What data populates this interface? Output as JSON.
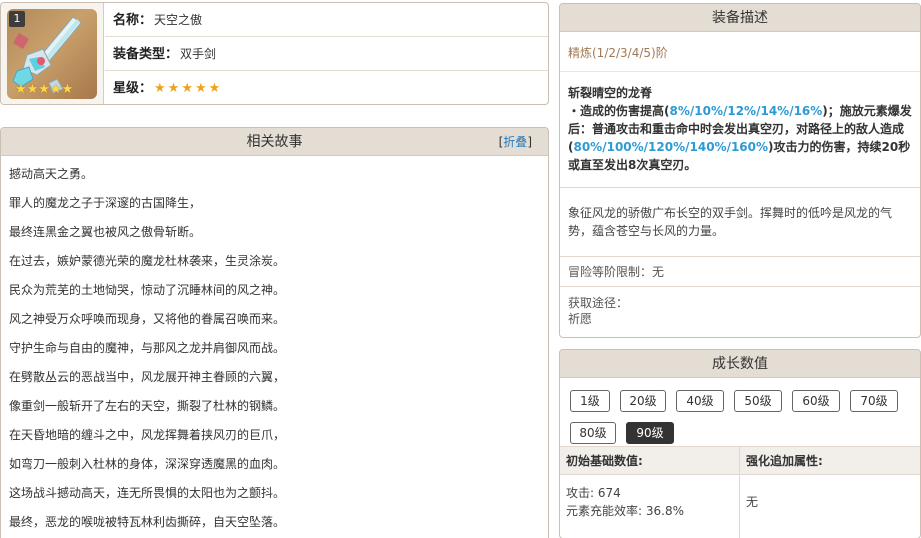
{
  "weapon": {
    "rank": "1",
    "name_label": "名称：",
    "name": "天空之傲",
    "type_label": "装备类型：",
    "type": "双手剑",
    "rarity_label": "星级：",
    "stars": "★★★★★",
    "portrait_stars": "★★★★★",
    "rarity_value": 5
  },
  "story": {
    "title": "相关故事",
    "toggle_open": "[",
    "toggle_label": "折叠",
    "toggle_close": "]",
    "lines": [
      "撼动高天之勇。",
      "罪人的魔龙之子于深邃的古国降生，",
      "最终连黑金之翼也被风之傲骨斩断。",
      "在过去，嫉妒蒙德光荣的魔龙杜林袭来，生灵涂炭。",
      "民众为荒芜的土地恸哭，惊动了沉睡林间的风之神。",
      "风之神受万众呼唤而现身，又将他的眷属召唤而来。",
      "守护生命与自由的魔神，与那风之龙并肩御风而战。",
      "在劈散丛云的恶战当中，风龙展开神主眷顾的六翼，",
      "像重剑一般斩开了左右的天空，撕裂了杜林的钢鳞。",
      "在天昏地暗的缠斗之中，风龙挥舞着挟风刃的巨爪，",
      "如弯刀一般刺入杜林的身体，深深穿透魔黑的血肉。",
      "这场战斗撼动高天，连无所畏惧的太阳也为之颤抖。",
      "最终，恶龙的喉咙被特瓦林利齿撕碎，自天空坠落。"
    ]
  },
  "description": {
    "title": "装备描述",
    "refine": "精炼(1/2/3/4/5)阶",
    "skill_name": "斩裂晴空的龙脊",
    "skill_bullet": "・造成的伤害提高(",
    "skill_hl1": "8%/10%/12%/14%/16%",
    "skill_mid": ")；施放元素爆发后：普通攻击和重击命中时会发出真空刃，对路径上的敌人造成(",
    "skill_hl2": "80%/100%/120%/140%/160%",
    "skill_end": ")攻击力的伤害，持续20秒或直至发出8次真空刃。",
    "flavor": "象征风龙的骄傲广布长空的双手剑。挥舞时的低吟是风龙的气势，蕴含苍空与长风的力量。",
    "limit": "冒险等阶限制：无",
    "source_label": "获取途径：",
    "source": "祈愿"
  },
  "growth": {
    "title": "成长数值",
    "levels": [
      "1级",
      "20级",
      "40级",
      "50级",
      "60级",
      "70级",
      "80级",
      "90级"
    ],
    "active_level": "90级",
    "base_header": "初始基础数值:",
    "bonus_header": "强化追加属性:",
    "atk": "攻击: 674",
    "er": "元素充能效率: 36.8%",
    "bonus": "无"
  },
  "colors": {
    "header_bg": "#e4ddd3",
    "highlight": "#2d9ad6",
    "star": "#f0a21a",
    "refine": "#a07a55"
  }
}
